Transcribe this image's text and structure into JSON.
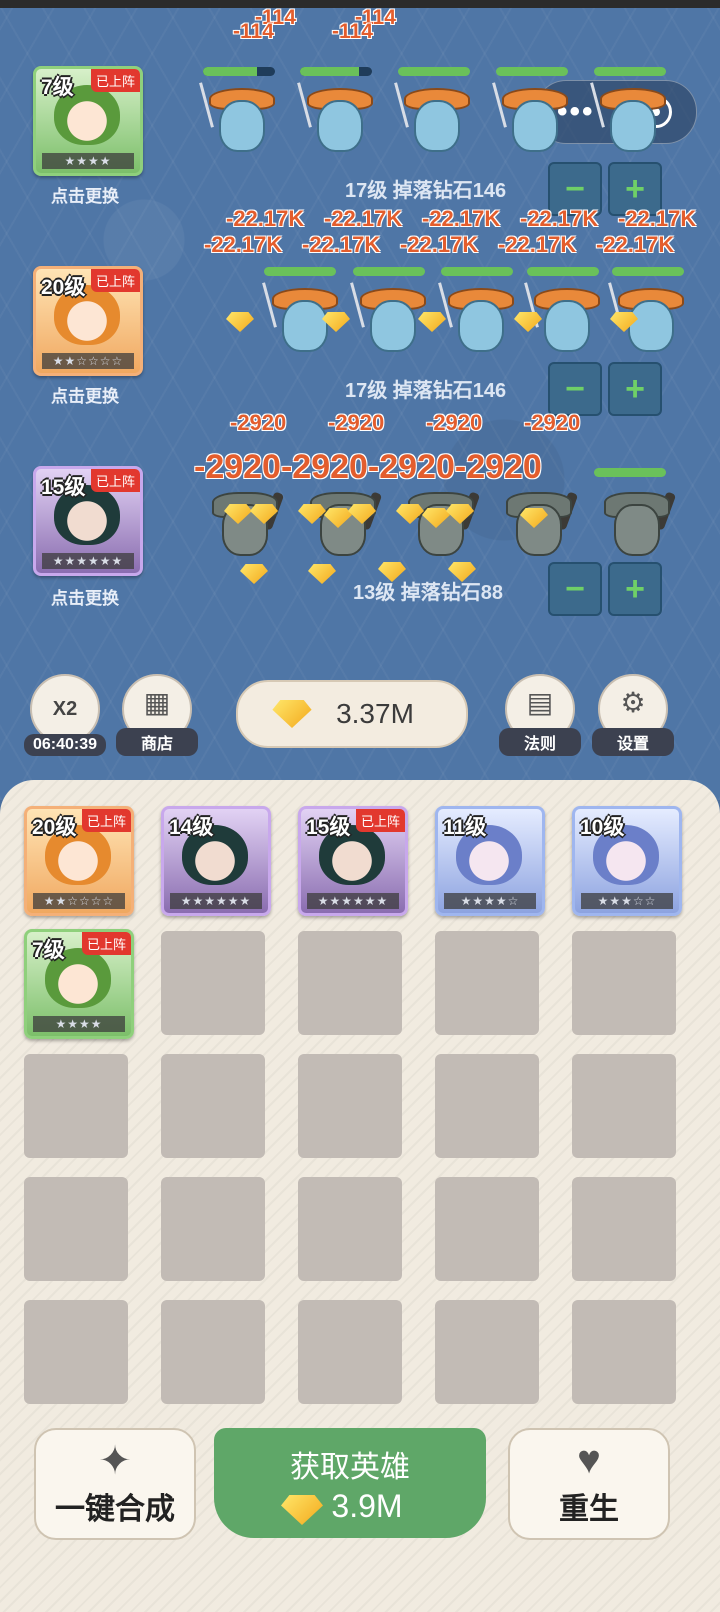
{
  "battle": {
    "top_damage": [
      "-114",
      "-114",
      "-114",
      "-114"
    ],
    "rows": [
      {
        "hero": {
          "level": "7级",
          "badge": "已上阵",
          "stars": "★★★★",
          "change": "点击更换"
        },
        "info": "17级 掉落钻石146",
        "damage_top": [
          "-22.17K",
          "-22.17K",
          "-22.17K",
          "-22.17K",
          "-22.17K"
        ],
        "damage_bottom": [
          "-22.17K",
          "-22.17K",
          "-22.17K",
          "-22.17K",
          "-22.17K"
        ]
      },
      {
        "hero": {
          "level": "20级",
          "badge": "已上阵",
          "stars": "★★☆☆☆☆",
          "change": "点击更换"
        },
        "info": "17级 掉落钻石146",
        "damage_top": [
          "-2920",
          "-2920",
          "-2920",
          "-2920"
        ],
        "damage_big": "-2920-2920-2920-2920"
      },
      {
        "hero": {
          "level": "15级",
          "badge": "已上阵",
          "stars": "★★★★★★",
          "change": "点击更换"
        },
        "info": "13级 掉落钻石88"
      }
    ],
    "minus": "−",
    "plus": "+"
  },
  "toolbar": {
    "double": {
      "icon": "X2",
      "timer": "06:40:39"
    },
    "shop": "商店",
    "gems": "3.37M",
    "rules": "法则",
    "settings": "设置"
  },
  "inventory": [
    {
      "level": "20级",
      "badge": "已上阵",
      "stars": "★★☆☆☆☆",
      "color": "orange"
    },
    {
      "level": "14级",
      "badge": "",
      "stars": "★★★★★★",
      "color": "purple"
    },
    {
      "level": "15级",
      "badge": "已上阵",
      "stars": "★★★★★★",
      "color": "purple"
    },
    {
      "level": "11级",
      "badge": "",
      "stars": "★★★★☆",
      "color": "blue"
    },
    {
      "level": "10级",
      "badge": "",
      "stars": "★★★☆☆",
      "color": "blue"
    },
    {
      "level": "7级",
      "badge": "已上阵",
      "stars": "★★★★",
      "color": "green"
    }
  ],
  "actions": {
    "merge": "一键合成",
    "get_hero": "获取英雄",
    "get_hero_cost": "3.9M",
    "rebirth": "重生"
  }
}
